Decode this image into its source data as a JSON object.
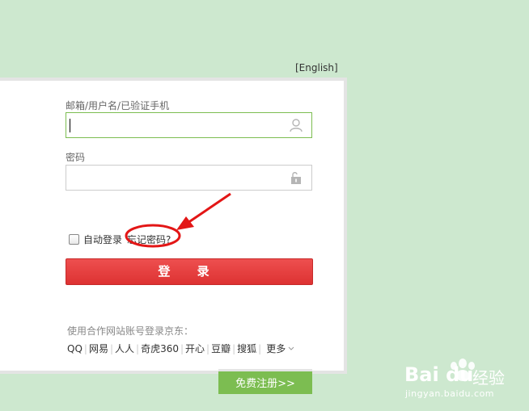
{
  "lang_link": "[English]",
  "login": {
    "username_label": "邮箱/用户名/已验证手机",
    "username_value": "",
    "password_label": "密码",
    "password_value": "",
    "remember_label": "自动登录",
    "forgot_label": "忘记密码?",
    "login_button": "登 录"
  },
  "partners": {
    "title": "使用合作网站账号登录京东：",
    "items": [
      "QQ",
      "网易",
      "人人",
      "奇虎360",
      "开心",
      "豆瓣",
      "搜狐"
    ],
    "more_label": "更多"
  },
  "register_button": "免费注册>>",
  "watermark": {
    "brand": "Bai du",
    "cn": "经验",
    "url": "jingyan.baidu.com"
  },
  "icons": {
    "username_field": "user-icon",
    "password_field": "lock-icon",
    "more": "chevron-down-icon"
  },
  "colors": {
    "background": "#cde8cf",
    "login_button": "#e23e3e",
    "register_button": "#7cbd51",
    "annotation": "#e31616"
  }
}
